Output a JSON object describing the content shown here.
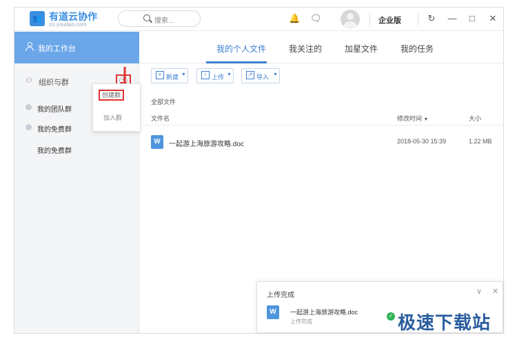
{
  "app": {
    "title": "有道云协作",
    "subtitle": "co.youdao.com",
    "search_placeholder": "搜索...",
    "edition": "企业版",
    "icons": [
      "bell-icon",
      "message-icon",
      "refresh-icon",
      "minimize-icon",
      "maximize-icon",
      "close-icon"
    ]
  },
  "sidebar": {
    "workspace": "我的工作台",
    "org_label": "组织与群",
    "groups": [
      "我的团队群",
      "我的免费群"
    ],
    "sub_item": "我的免费群"
  },
  "popup": {
    "create": "创建群",
    "join": "加入群"
  },
  "tabs": [
    "我的个人文件",
    "我关注的",
    "加星文件",
    "我的任务"
  ],
  "toolbar": {
    "new": "新建",
    "upload": "上传",
    "import": "导入"
  },
  "breadcrumb": "全部文件",
  "table": {
    "col_name": "文件名",
    "col_modified": "修改时间",
    "col_size": "大小",
    "rows": [
      {
        "icon": "W",
        "name": "一起游上海旅游攻略.doc",
        "modified": "2018-05-30 15:39",
        "size": "1.22 MB"
      }
    ]
  },
  "toast": {
    "title": "上传完成",
    "file_name": "一起游上海旅游攻略.doc",
    "status": "上传完成"
  },
  "watermark": "极速下载站",
  "colors": {
    "accent": "#3b7fd1",
    "sidebar_active": "#6aa6e8",
    "highlight": "#e03030",
    "success": "#33b25a"
  }
}
